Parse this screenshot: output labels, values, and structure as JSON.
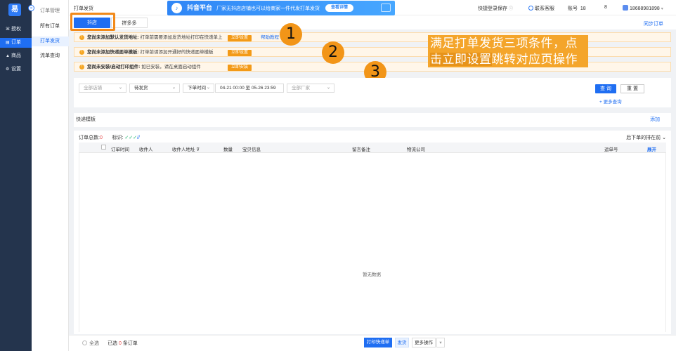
{
  "sidebar": {
    "logo": "易",
    "collapse": "«",
    "items": [
      {
        "icon": "⌘",
        "label": "授权",
        "active": false
      },
      {
        "icon": "▤",
        "label": "订单",
        "active": true
      },
      {
        "icon": "▲",
        "label": "商品",
        "active": false
      },
      {
        "icon": "⚙",
        "label": "设置",
        "active": false
      }
    ]
  },
  "submenu": {
    "head": "订单管理",
    "items": [
      "所有订单",
      "打单发货",
      "流单查询"
    ]
  },
  "topbar": {
    "breadcrumb": "打单发货",
    "banner_main": "抖音平台",
    "banner_sub": "厂家无抖店店铺也可以给商家一件代发打单发货",
    "banner_button": "查看详情",
    "quick_login": "快捷登录保存",
    "customer_service": "联系客服",
    "account_label": "账号",
    "account_value": "18",
    "count": "8",
    "phone": "18688981898"
  },
  "tabs": {
    "douyin": "抖店",
    "pdd": "拼多多",
    "sync": "同步订单"
  },
  "alerts": [
    {
      "title": "您尚未添加默认发货地址:",
      "text": "打单前需要添加发货地址打印在快递单上",
      "button": "立即设置",
      "link": "帮助教程"
    },
    {
      "title": "您尚未添加快递面单模板:",
      "text": "打单前请添加开通好的快递面单模板",
      "button": "立即设置",
      "link": ""
    },
    {
      "title": "您尚未安装/启动打印组件:",
      "text": "如已安装，请在桌面启动组件",
      "button": "立即安装",
      "link": ""
    }
  ],
  "annotation": {
    "numbers": [
      "1",
      "2",
      "3"
    ],
    "line1": "满足打单发货三项条件，点",
    "line2_a": "击立即设置",
    "line2_b": "跳转对应页操作"
  },
  "filters": {
    "shop": "全部店铺",
    "status": "待发货",
    "time_type": "下单时间",
    "date_from": "04-21 00:00",
    "date_sep": "至",
    "date_to": "05-26 23:59",
    "factory": "全部厂家",
    "search": "查 询",
    "reset": "重 置",
    "more": "+ 更多查询"
  },
  "template": {
    "label": "快递模板",
    "add": "添加"
  },
  "table": {
    "total_label": "订单总数:",
    "total_value": "0",
    "mark_label": "标识:",
    "mark_icons": "✓✓✓",
    "mark_slash": "//",
    "sort": "后下单的排在前 ⌄",
    "columns": [
      "订单时间",
      "收件人",
      "收件人地址",
      "数量",
      "宝贝信息",
      "留言备注",
      "物流公司",
      "运单号",
      "展开"
    ],
    "empty": "暂无数据"
  },
  "footer": {
    "select_all": "全选",
    "selected_prefix": "已选",
    "selected_count": "0",
    "selected_suffix": "条订单",
    "print": "打印快递单",
    "ship": "发货",
    "more_ops": "更多操作",
    "more_caret": "▾"
  }
}
